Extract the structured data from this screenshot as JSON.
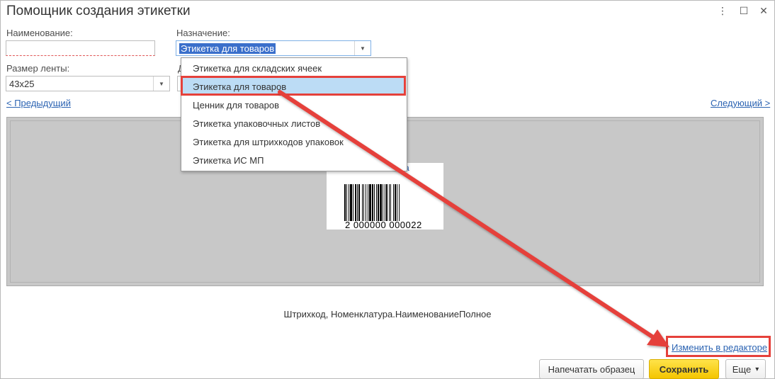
{
  "window": {
    "title": "Помощник создания этикетки",
    "menu_icon": "⋮",
    "maximize_icon": "☐",
    "close_icon": "✕"
  },
  "fields": {
    "name_label": "Наименование:",
    "name_value": "",
    "purpose_label": "Назначение:",
    "purpose_value": "Этикетка для товаров",
    "tape_label": "Размер ленты:",
    "tape_value": "43x25",
    "hidden_label_fragment": "Д"
  },
  "nav": {
    "prev": "< Предыдущий",
    "next": "Следующий >"
  },
  "dropdown": {
    "options": [
      "Этикетка для складских ячеек",
      "Этикетка для товаров",
      "Ценник для товаров",
      "Этикетка упаковочных листов",
      "Этикетка для штрихкодов упаковок",
      "Этикетка ИС МП"
    ],
    "selected_index": 1
  },
  "preview": {
    "barcode_number": "2 000000 000022",
    "card_fragment": "а"
  },
  "footer": {
    "fields_text": "Штрихкод, Номенклатура.НаименованиеПолное",
    "edit_link": "Изменить в редакторе",
    "print_sample": "Напечатать образец",
    "save": "Сохранить",
    "more": "Еще",
    "more_icon": "▾"
  },
  "colors": {
    "annotation": "#e5413b",
    "link": "#2b63b2",
    "primary_button": "#f4c500",
    "selected_option": "#bcdcf5"
  }
}
